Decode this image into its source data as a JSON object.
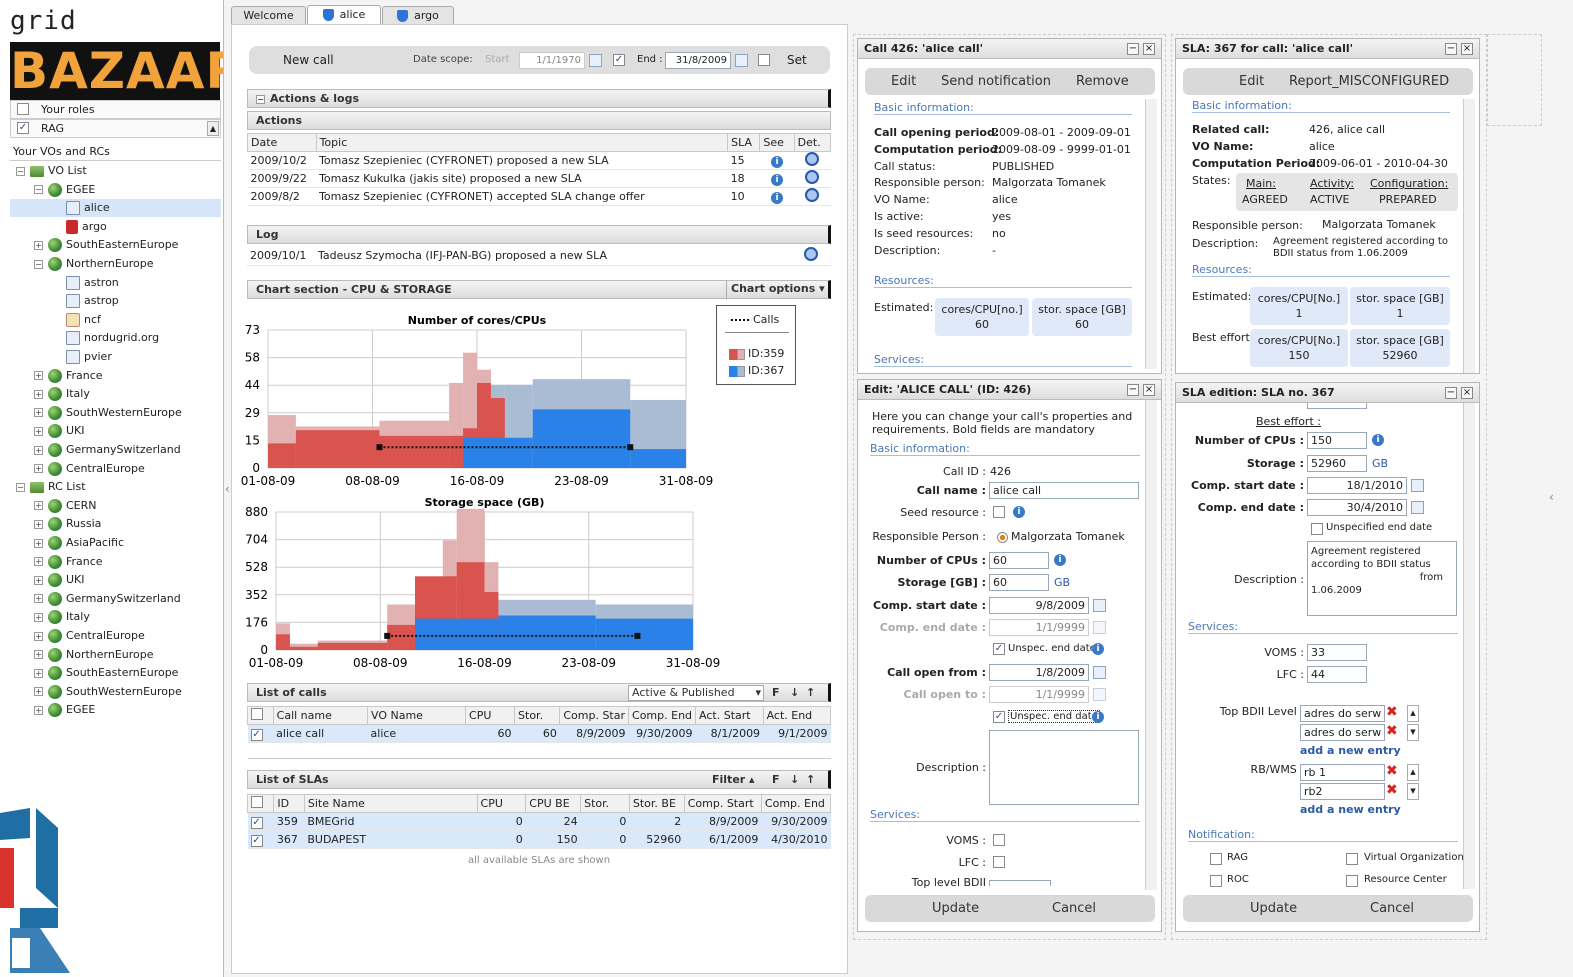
{
  "app": {
    "logo_top": "grid resource",
    "logo_main": "BAZAAR"
  },
  "roles": {
    "your_roles": "Your roles",
    "rag": "RAG"
  },
  "tree": {
    "header": "Your VOs and RCs",
    "nodes": [
      {
        "label": "VO List",
        "tog": "−",
        "icon": "folder",
        "level": 0
      },
      {
        "label": "EGEE",
        "tog": "−",
        "icon": "globe",
        "level": 1
      },
      {
        "label": "alice",
        "tog": "",
        "icon": "sq",
        "level": 2,
        "sel": true
      },
      {
        "label": "argo",
        "tog": "",
        "icon": "red",
        "level": 2
      },
      {
        "label": "SouthEasternEurope",
        "tog": "+",
        "icon": "globe",
        "level": 1
      },
      {
        "label": "NorthernEurope",
        "tog": "−",
        "icon": "globe",
        "level": 1
      },
      {
        "label": "astron",
        "tog": "",
        "icon": "sq",
        "level": 2
      },
      {
        "label": "astrop",
        "tog": "",
        "icon": "sq",
        "level": 2
      },
      {
        "label": "ncf",
        "tog": "",
        "icon": "user",
        "level": 2
      },
      {
        "label": "nordugrid.org",
        "tog": "",
        "icon": "sq",
        "level": 2
      },
      {
        "label": "pvier",
        "tog": "",
        "icon": "sq",
        "level": 2
      },
      {
        "label": "France",
        "tog": "+",
        "icon": "globe",
        "level": 1
      },
      {
        "label": "Italy",
        "tog": "+",
        "icon": "globe",
        "level": 1
      },
      {
        "label": "SouthWesternEurope",
        "tog": "+",
        "icon": "globe",
        "level": 1
      },
      {
        "label": "UKI",
        "tog": "+",
        "icon": "globe",
        "level": 1
      },
      {
        "label": "GermanySwitzerland",
        "tog": "+",
        "icon": "globe",
        "level": 1
      },
      {
        "label": "CentralEurope",
        "tog": "+",
        "icon": "globe",
        "level": 1
      },
      {
        "label": "RC List",
        "tog": "−",
        "icon": "folder",
        "level": 0
      },
      {
        "label": "CERN",
        "tog": "+",
        "icon": "globe",
        "level": 1
      },
      {
        "label": "Russia",
        "tog": "+",
        "icon": "globe",
        "level": 1
      },
      {
        "label": "AsiaPacific",
        "tog": "+",
        "icon": "globe",
        "level": 1
      },
      {
        "label": "France",
        "tog": "+",
        "icon": "globe",
        "level": 1
      },
      {
        "label": "UKI",
        "tog": "+",
        "icon": "globe",
        "level": 1
      },
      {
        "label": "GermanySwitzerland",
        "tog": "+",
        "icon": "globe",
        "level": 1
      },
      {
        "label": "Italy",
        "tog": "+",
        "icon": "globe",
        "level": 1
      },
      {
        "label": "CentralEurope",
        "tog": "+",
        "icon": "globe",
        "level": 1
      },
      {
        "label": "NorthernEurope",
        "tog": "+",
        "icon": "globe",
        "level": 1
      },
      {
        "label": "SouthEasternEurope",
        "tog": "+",
        "icon": "globe",
        "level": 1
      },
      {
        "label": "SouthWesternEurope",
        "tog": "+",
        "icon": "globe",
        "level": 1
      },
      {
        "label": "EGEE",
        "tog": "+",
        "icon": "globe",
        "level": 1
      }
    ]
  },
  "tabs": {
    "welcome": "Welcome",
    "alice": "alice",
    "argo": "argo"
  },
  "toolbar": {
    "new_call": "New call",
    "date_scope": "Date scope:",
    "start_label": "Start",
    "start_value": "1/1/1970",
    "end_label": "End :",
    "end_value": "31/8/2009",
    "set": "Set"
  },
  "actions": {
    "title": "Actions & logs",
    "sub": "Actions",
    "columns": [
      "Date",
      "Topic",
      "SLA",
      "See",
      "Det."
    ],
    "rows": [
      {
        "date": "2009/10/2",
        "topic": "Tomasz Szepieniec (CYFRONET) proposed a new SLA",
        "sla": "15"
      },
      {
        "date": "2009/9/22",
        "topic": "Tomasz Kukulka (jakis site) proposed a new SLA",
        "sla": "18"
      },
      {
        "date": "2009/8/2",
        "topic": "Tomasz Szepieniec (CYFRONET) accepted SLA change offer",
        "sla": "10"
      }
    ],
    "log_title": "Log",
    "log_rows": [
      {
        "date": "2009/10/1",
        "topic": "Tadeusz Szymocha (IFJ-PAN-BG) proposed a new SLA"
      }
    ]
  },
  "chart_section": {
    "title": "Chart section - CPU & STORAGE",
    "options": "Chart options"
  },
  "chart_data": [
    {
      "type": "area",
      "title": "Number of cores/CPUs",
      "xlabel": "",
      "ylabel": "",
      "xticks": [
        "01-08-09",
        "08-08-09",
        "16-08-09",
        "23-08-09",
        "31-08-09"
      ],
      "yticks": [
        "0",
        "15",
        "29",
        "44",
        "58",
        "73"
      ],
      "ylim": [
        0,
        73
      ],
      "x_days": [
        1,
        3,
        9,
        14,
        15,
        16,
        17,
        18,
        20,
        27,
        31
      ],
      "series": [
        {
          "name": "ID:359",
          "color": "#d9534f",
          "light": "#e2b1b1",
          "values": [
            13,
            20,
            17,
            17,
            21,
            45,
            37,
            0,
            0,
            0
          ]
        },
        {
          "name": "ID:367",
          "color": "#2a82e8",
          "light": "#a9bcd3",
          "values": [
            0,
            0,
            0,
            0,
            16,
            16,
            16,
            16,
            21,
            0
          ]
        }
      ],
      "calls": {
        "name": "Calls",
        "from": "09-08-09",
        "to": "31-08-09",
        "value": 11
      }
    },
    {
      "type": "area",
      "title": "Storage space (GB)",
      "xlabel": "",
      "ylabel": "",
      "xticks": [
        "01-08-09",
        "08-08-09",
        "16-08-09",
        "23-08-09",
        "31-08-09"
      ],
      "yticks": [
        "0",
        "176",
        "352",
        "528",
        "704",
        "880"
      ],
      "ylim": [
        0,
        880
      ],
      "calls": {
        "name": "Calls",
        "from": "09-08-09",
        "to": "31-08-09",
        "value": 90
      }
    }
  ],
  "legend": {
    "calls": "Calls",
    "s1": "ID:359",
    "s2": "ID:367"
  },
  "calls_list": {
    "title": "List of calls",
    "filter": "Active & Published",
    "columns": [
      "Call name",
      "VO Name",
      "CPU",
      "Stor.",
      "Comp. Star",
      "Comp. End",
      "Act. Start",
      "Act. End"
    ],
    "rows": [
      {
        "name": "alice call",
        "vo": "alice",
        "cpu": "60",
        "stor": "60",
        "cstart": "8/9/2009",
        "cend": "9/30/2009",
        "astart": "8/1/2009",
        "aend": "9/1/2009"
      }
    ]
  },
  "slas_list": {
    "title": "List of SLAs",
    "filter": "Filter",
    "columns": [
      "ID",
      "Site Name",
      "CPU",
      "CPU BE",
      "Stor.",
      "Stor. BE",
      "Comp. Start",
      "Comp. End"
    ],
    "rows": [
      {
        "id": "359",
        "site": "BMEGrid",
        "cpu": "0",
        "cpube": "24",
        "stor": "0",
        "storbe": "2",
        "cstart": "8/9/2009",
        "cend": "9/30/2009"
      },
      {
        "id": "367",
        "site": "BUDAPEST",
        "cpu": "0",
        "cpube": "150",
        "stor": "0",
        "storbe": "52960",
        "cstart": "6/1/2009",
        "cend": "4/30/2010"
      }
    ],
    "footer": "all available SLAs are shown"
  },
  "call_panel": {
    "title": "Call 426: 'alice call'",
    "edit": "Edit",
    "notify": "Send notification",
    "remove": "Remove",
    "basic": "Basic information:",
    "fields": [
      {
        "k": "Call opening period:",
        "v": "2009-08-01 - 2009-09-01",
        "bold": true
      },
      {
        "k": "Computation period:",
        "v": "2009-08-09 - 9999-01-01",
        "bold": true
      },
      {
        "k": "Call status:",
        "v": "PUBLISHED"
      },
      {
        "k": "Responsible person:",
        "v": "Malgorzata Tomanek"
      },
      {
        "k": "VO Name:",
        "v": "alice"
      },
      {
        "k": "Is active:",
        "v": "yes"
      },
      {
        "k": "Is seed resources:",
        "v": "no"
      },
      {
        "k": "Description:",
        "v": "-"
      }
    ],
    "resources": "Resources:",
    "estimated": "Estimated:",
    "cpu_box": "cores/CPU[no.]",
    "cpu_val": "60",
    "stor_box": "stor. space [GB]",
    "stor_val": "60",
    "services": "Services:"
  },
  "sla_panel": {
    "title": "SLA: 367 for call: 'alice call'",
    "edit": "Edit",
    "report": "Report_MISCONFIGURED",
    "basic": "Basic information:",
    "related_k": "Related call:",
    "related_v": "426, alice call",
    "vo_k": "VO Name:",
    "vo_v": "alice",
    "comp_k": "Computation Period:",
    "comp_v": "2009-06-01 - 2010-04-30",
    "states_k": "States:",
    "states": [
      {
        "h": "Main:",
        "v": "AGREED"
      },
      {
        "h": "Activity:",
        "v": "ACTIVE"
      },
      {
        "h": "Configuration:",
        "v": "PREPARED"
      }
    ],
    "resp_k": "Responsible person:",
    "resp_v": "Malgorzata Tomanek",
    "desc_k": "Description:",
    "desc_v1": "Agreement registered according to",
    "desc_v2": "BDII status from 1.06.2009",
    "resources": "Resources:",
    "estimated": "Estimated:",
    "best": "Best effort:",
    "cpu_box": "cores/CPU[No.]",
    "cpu_est": "1",
    "stor_box": "stor. space [GB]",
    "stor_est": "1",
    "cpu_best": "150",
    "stor_best": "52960"
  },
  "edit_panel": {
    "title": "Edit: 'ALICE CALL' (ID: 426)",
    "intro1": "Here you can change your call's properties and",
    "intro2": "requirements. Bold fields are mandatory",
    "basic": "Basic information:",
    "callid_k": "Call ID :",
    "callid_v": "426",
    "name_k": "Call name :",
    "name_v": "alice call",
    "seed_k": "Seed resource :",
    "resp_k": "Responsible Person :",
    "resp_v": "Malgorzata Tomanek",
    "cpus_k": "Number of CPUs :",
    "cpus_v": "60",
    "stor_k": "Storage [GB] :",
    "stor_v": "60",
    "stor_unit": "GB",
    "cstart_k": "Comp. start date :",
    "cstart_v": "9/8/2009",
    "cend_k": "Comp. end date :",
    "cend_v": "1/1/9999",
    "unspec": "Unspec. end date",
    "open_k": "Call open from :",
    "open_v": "1/8/2009",
    "to_k": "Call open to :",
    "to_v": "1/1/9999",
    "unspec2": "Unspec. end date",
    "desc_k": "Description :",
    "services": "Services:",
    "voms_k": "VOMS :",
    "lfc_k": "LFC :",
    "bdii_k": "Top level BDII",
    "update": "Update",
    "cancel": "Cancel"
  },
  "sla_edit": {
    "title": "SLA edition: SLA no. 367",
    "best": "Best effort :",
    "cpus_k": "Number of CPUs :",
    "cpus_v": "150",
    "stor_k": "Storage :",
    "stor_v": "52960",
    "stor_unit": "GB",
    "cstart_k": "Comp. start date :",
    "cstart_v": "18/1/2010",
    "cend_k": "Comp. end date :",
    "cend_v": "30/4/2010",
    "unspec": "Unspecified end date",
    "desc_k": "Description :",
    "desc_v1": "Agreement registered",
    "desc_v2": "according to BDII status",
    "desc_v3": "from",
    "desc_v4": "1.06.2009",
    "services": "Services:",
    "voms_k": "VOMS :",
    "voms_v": "33",
    "lfc_k": "LFC :",
    "lfc_v": "44",
    "bdii_k": "Top BDII Level :",
    "bdii_1": "adres do serw",
    "bdii_2": "adres do serw",
    "add": "add a new entry",
    "rb_k": "RB/WMS :",
    "rb_1": "rb 1",
    "rb_2": "rb2",
    "notif": "Notification:",
    "rag": "RAG",
    "vo": "Virtual Organization",
    "roc": "ROC",
    "rc": "Resource Center",
    "update": "Update",
    "cancel": "Cancel"
  }
}
